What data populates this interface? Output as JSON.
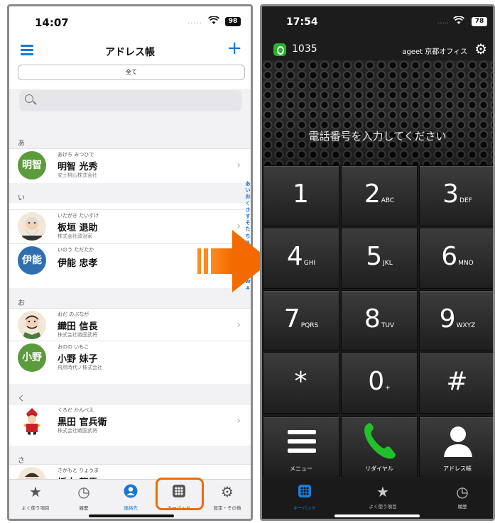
{
  "left_phone": {
    "status": {
      "time": "14:07",
      "battery": "98",
      "signal": "....."
    },
    "nav": {
      "title": "アドレス帳"
    },
    "segment": {
      "label": "全て"
    },
    "sections": [
      {
        "header": "あ",
        "contacts": [
          {
            "kana": "あけち みつひで",
            "name": "明智 光秀",
            "company": "安土桃山株式会社",
            "avatar_text": "明智",
            "avatar_color": "#5c9b3c"
          }
        ]
      },
      {
        "header": "い",
        "contacts": [
          {
            "kana": "いたがき たいすけ",
            "name": "板垣 退助",
            "company": "株式会社政治家",
            "avatar_text": "",
            "avatar_color": "#f3e7d7"
          },
          {
            "kana": "いのう ただたか",
            "name": "伊能 忠孝",
            "company": "",
            "avatar_text": "伊能",
            "avatar_color": "#2f6fb0"
          }
        ]
      },
      {
        "header": "お",
        "contacts": [
          {
            "kana": "おだ のぶなが",
            "name": "織田 信長",
            "company": "株式会社戦国武将",
            "avatar_text": "",
            "avatar_color": "#f3e7d7"
          },
          {
            "kana": "おのの いもこ",
            "name": "小野 妹子",
            "company": "飛鳥時代ノ株式会社",
            "avatar_text": "小野",
            "avatar_color": "#5c9b3c"
          }
        ]
      },
      {
        "header": "く",
        "contacts": [
          {
            "kana": "くろだ かんべえ",
            "name": "黒田 官兵衛",
            "company": "株式会社戦国武将",
            "avatar_text": "",
            "avatar_color": "#f3e7d7"
          }
        ]
      },
      {
        "header": "さ",
        "contacts": [
          {
            "kana": "さかもと りょうま",
            "name": "坂本 龍馬",
            "company": "",
            "avatar_text": "",
            "avatar_color": "#f3e7d7"
          }
        ]
      }
    ],
    "index": [
      "あ",
      "い",
      "お",
      "く",
      "さ",
      "す",
      "そ",
      "た",
      "ち",
      "B",
      "C",
      "D",
      "F",
      "M",
      "T",
      "W",
      "#"
    ],
    "tabs": [
      {
        "label": "よく使う項目",
        "icon": "star-icon"
      },
      {
        "label": "履歴",
        "icon": "clock-icon"
      },
      {
        "label": "連絡先",
        "icon": "person-icon"
      },
      {
        "label": "キーパッド",
        "icon": "keypad-icon"
      },
      {
        "label": "設定・その他",
        "icon": "gear-icon"
      }
    ],
    "active_tab": "連絡先",
    "highlight_color": "#f06a00"
  },
  "right_phone": {
    "status": {
      "time": "17:54",
      "battery": "78",
      "signal": "....."
    },
    "extension": "1035",
    "office": "ageet 京都オフィス",
    "prompt": "電話番号を入力してください",
    "keys": [
      {
        "d": "1",
        "s": ""
      },
      {
        "d": "2",
        "s": "ABC"
      },
      {
        "d": "3",
        "s": "DEF"
      },
      {
        "d": "4",
        "s": "GHI"
      },
      {
        "d": "5",
        "s": "JKL"
      },
      {
        "d": "6",
        "s": "MNO"
      },
      {
        "d": "7",
        "s": "PQRS"
      },
      {
        "d": "8",
        "s": "TUV"
      },
      {
        "d": "9",
        "s": "WXYZ"
      },
      {
        "d": "*",
        "s": ""
      },
      {
        "d": "0",
        "s": "+"
      },
      {
        "d": "#",
        "s": ""
      }
    ],
    "bottom": {
      "menu": "メニュー",
      "redial": "リダイヤル",
      "address": "アドレス帳"
    },
    "tabs": [
      {
        "label": "キーパッド",
        "icon": "keypad-icon"
      },
      {
        "label": "よく使う項目",
        "icon": "star-icon"
      },
      {
        "label": "履歴",
        "icon": "clock-icon"
      }
    ],
    "active_tab": "キーパッド",
    "accent_color": "#1a7fe0",
    "call_color": "#22c02a"
  }
}
